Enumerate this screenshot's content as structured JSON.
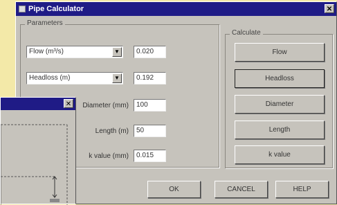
{
  "main_window": {
    "title": "Pipe Calculator",
    "close_glyph": "✕"
  },
  "parameters": {
    "legend": "Parameters",
    "combo1": {
      "value": "Flow (m³/s)",
      "field": "0.020"
    },
    "combo2": {
      "value": "Headloss (m)",
      "field": "0.192"
    },
    "rows": [
      {
        "label": "Diameter (mm)",
        "value": "100"
      },
      {
        "label": "Length (m)",
        "value": "50"
      },
      {
        "label": "k value (mm)",
        "value": "0.015"
      }
    ]
  },
  "calculate": {
    "legend": "Calculate",
    "buttons": [
      "Flow",
      "Headloss",
      "Diameter",
      "Length",
      "k value"
    ]
  },
  "footer": {
    "ok": "OK",
    "cancel": "CANCEL",
    "help": "HELP"
  },
  "back_window": {
    "close_glyph": "✕"
  }
}
